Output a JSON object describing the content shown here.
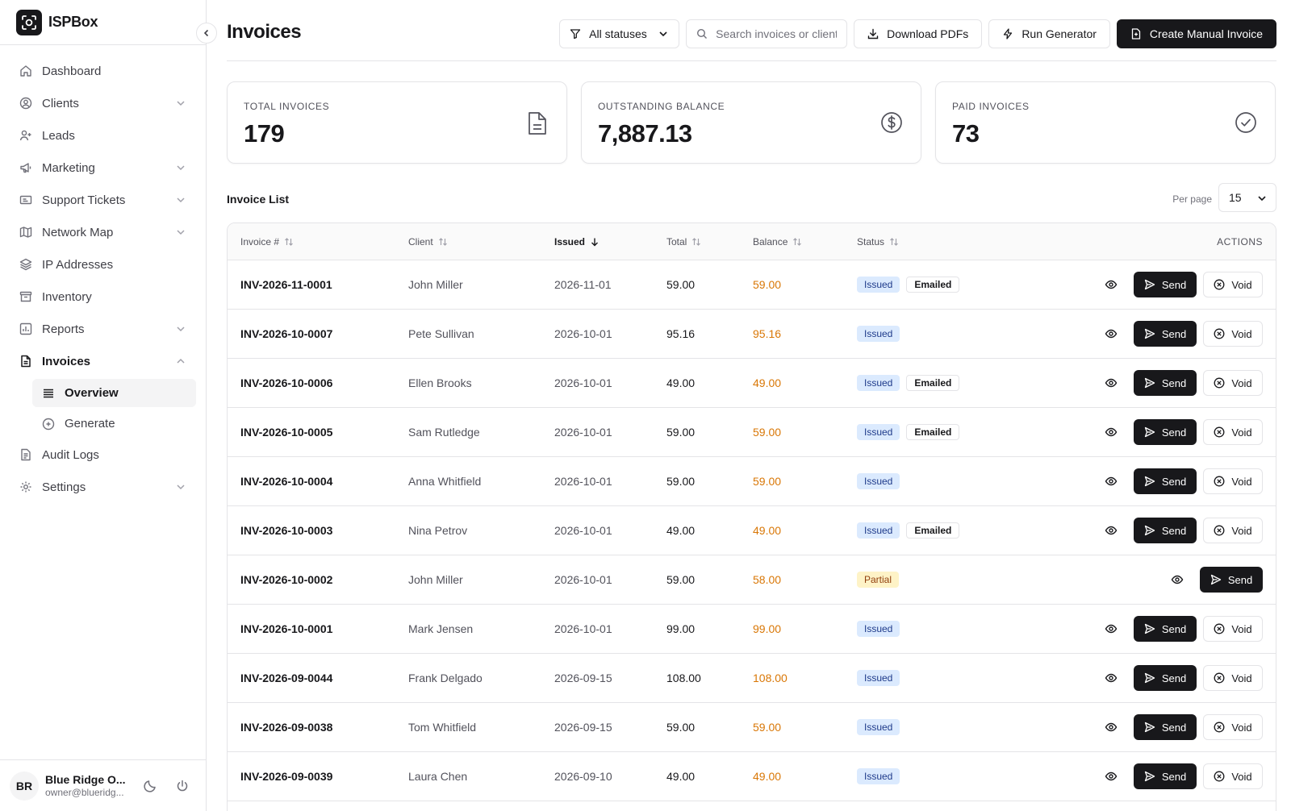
{
  "app": {
    "name": "ISPBox"
  },
  "sidebar": {
    "items": [
      {
        "label": "Dashboard",
        "icon": "home-icon",
        "expandable": false
      },
      {
        "label": "Clients",
        "icon": "user-circle-icon",
        "expandable": true
      },
      {
        "label": "Leads",
        "icon": "user-plus-icon",
        "expandable": false
      },
      {
        "label": "Marketing",
        "icon": "megaphone-icon",
        "expandable": true
      },
      {
        "label": "Support Tickets",
        "icon": "ticket-icon",
        "expandable": true
      },
      {
        "label": "Network Map",
        "icon": "map-icon",
        "expandable": true
      },
      {
        "label": "IP Addresses",
        "icon": "layers-icon",
        "expandable": false
      },
      {
        "label": "Inventory",
        "icon": "archive-icon",
        "expandable": false
      },
      {
        "label": "Reports",
        "icon": "chart-icon",
        "expandable": true
      },
      {
        "label": "Invoices",
        "icon": "file-icon",
        "expandable": true,
        "expanded": true
      },
      {
        "label": "Audit Logs",
        "icon": "file-list-icon",
        "expandable": false
      },
      {
        "label": "Settings",
        "icon": "gear-icon",
        "expandable": true
      }
    ],
    "invoices_sub": [
      {
        "label": "Overview",
        "icon": "list-icon",
        "selected": true
      },
      {
        "label": "Generate",
        "icon": "plus-circle-icon",
        "selected": false
      }
    ],
    "user": {
      "initials": "BR",
      "name": "Blue Ridge O...",
      "email": "owner@blueridg..."
    }
  },
  "header": {
    "title": "Invoices",
    "status_filter": "All statuses",
    "search_placeholder": "Search invoices or clients",
    "download_label": "Download PDFs",
    "generator_label": "Run Generator",
    "create_label": "Create Manual Invoice"
  },
  "stats": [
    {
      "label": "TOTAL INVOICES",
      "value": "179",
      "icon": "document-icon"
    },
    {
      "label": "OUTSTANDING BALANCE",
      "value": "7,887.13",
      "icon": "dollar-circle-icon"
    },
    {
      "label": "PAID INVOICES",
      "value": "73",
      "icon": "check-circle-icon"
    }
  ],
  "list": {
    "title": "Invoice List",
    "per_page_label": "Per page",
    "per_page_value": "15",
    "columns": {
      "invoice": "Invoice #",
      "client": "Client",
      "issued": "Issued",
      "total": "Total",
      "balance": "Balance",
      "status": "Status",
      "actions": "ACTIONS"
    },
    "send_label": "Send",
    "void_label": "Void",
    "rows": [
      {
        "invoice": "INV-2026-11-0001",
        "client": "John Miller",
        "issued": "2026-11-01",
        "total": "59.00",
        "balance": "59.00",
        "status": "Issued",
        "emailed": true,
        "voidable": true
      },
      {
        "invoice": "INV-2026-10-0007",
        "client": "Pete Sullivan",
        "issued": "2026-10-01",
        "total": "95.16",
        "balance": "95.16",
        "status": "Issued",
        "emailed": false,
        "voidable": true
      },
      {
        "invoice": "INV-2026-10-0006",
        "client": "Ellen Brooks",
        "issued": "2026-10-01",
        "total": "49.00",
        "balance": "49.00",
        "status": "Issued",
        "emailed": true,
        "voidable": true
      },
      {
        "invoice": "INV-2026-10-0005",
        "client": "Sam Rutledge",
        "issued": "2026-10-01",
        "total": "59.00",
        "balance": "59.00",
        "status": "Issued",
        "emailed": true,
        "voidable": true
      },
      {
        "invoice": "INV-2026-10-0004",
        "client": "Anna Whitfield",
        "issued": "2026-10-01",
        "total": "59.00",
        "balance": "59.00",
        "status": "Issued",
        "emailed": false,
        "voidable": true
      },
      {
        "invoice": "INV-2026-10-0003",
        "client": "Nina Petrov",
        "issued": "2026-10-01",
        "total": "49.00",
        "balance": "49.00",
        "status": "Issued",
        "emailed": true,
        "voidable": true
      },
      {
        "invoice": "INV-2026-10-0002",
        "client": "John Miller",
        "issued": "2026-10-01",
        "total": "59.00",
        "balance": "58.00",
        "status": "Partial",
        "emailed": false,
        "voidable": false
      },
      {
        "invoice": "INV-2026-10-0001",
        "client": "Mark Jensen",
        "issued": "2026-10-01",
        "total": "99.00",
        "balance": "99.00",
        "status": "Issued",
        "emailed": false,
        "voidable": true
      },
      {
        "invoice": "INV-2026-09-0044",
        "client": "Frank Delgado",
        "issued": "2026-09-15",
        "total": "108.00",
        "balance": "108.00",
        "status": "Issued",
        "emailed": false,
        "voidable": true
      },
      {
        "invoice": "INV-2026-09-0038",
        "client": "Tom Whitfield",
        "issued": "2026-09-15",
        "total": "59.00",
        "balance": "59.00",
        "status": "Issued",
        "emailed": false,
        "voidable": true
      },
      {
        "invoice": "INV-2026-09-0039",
        "client": "Laura Chen",
        "issued": "2026-09-10",
        "total": "49.00",
        "balance": "49.00",
        "status": "Issued",
        "emailed": false,
        "voidable": true
      }
    ],
    "emailed_label": "Emailed"
  },
  "colors": {
    "accent": "#18181b",
    "balance": "#d97706",
    "issued_bg": "#dbeafe",
    "partial_bg": "#fef3c7"
  }
}
